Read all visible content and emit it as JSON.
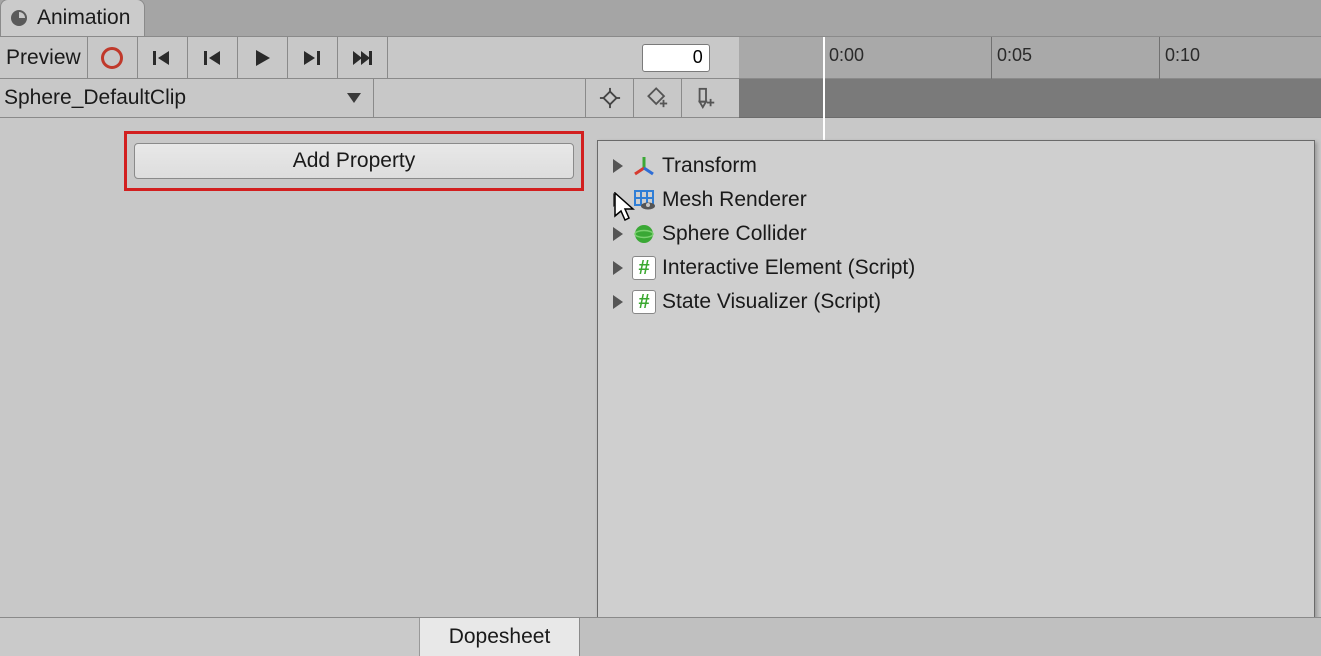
{
  "tab": {
    "title": "Animation"
  },
  "toolbar": {
    "preview_label": "Preview",
    "frame_value": "0"
  },
  "timeline": {
    "labels": [
      "0:00",
      "0:05",
      "0:10"
    ]
  },
  "clip": {
    "name": "Sphere_DefaultClip"
  },
  "add_property_label": "Add Property",
  "popup": {
    "items": [
      {
        "label": "Transform",
        "icon": "transform"
      },
      {
        "label": "Mesh Renderer",
        "icon": "mesh"
      },
      {
        "label": "Sphere Collider",
        "icon": "sphere"
      },
      {
        "label": "Interactive Element (Script)",
        "icon": "script"
      },
      {
        "label": "State Visualizer (Script)",
        "icon": "script"
      }
    ]
  },
  "bottom": {
    "dopesheet_label": "Dopesheet"
  }
}
